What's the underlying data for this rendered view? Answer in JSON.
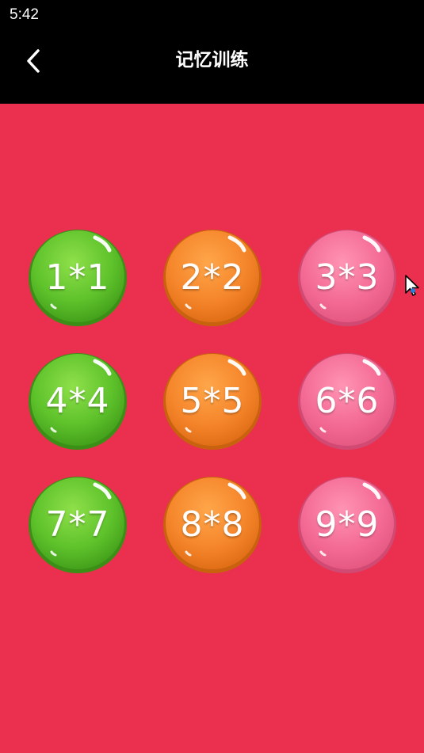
{
  "status_bar": {
    "time": "5:42"
  },
  "header": {
    "title": "记忆训练",
    "back_icon": "chevron-left-icon"
  },
  "colors": {
    "background": "#ea2f4f",
    "green": "#5ec22b",
    "orange": "#f5852a",
    "pink": "#f46b95"
  },
  "levels": [
    {
      "label": "1*1",
      "color": "green"
    },
    {
      "label": "2*2",
      "color": "orange"
    },
    {
      "label": "3*3",
      "color": "pink"
    },
    {
      "label": "4*4",
      "color": "green"
    },
    {
      "label": "5*5",
      "color": "orange"
    },
    {
      "label": "6*6",
      "color": "pink"
    },
    {
      "label": "7*7",
      "color": "green"
    },
    {
      "label": "8*8",
      "color": "orange"
    },
    {
      "label": "9*9",
      "color": "pink"
    }
  ]
}
